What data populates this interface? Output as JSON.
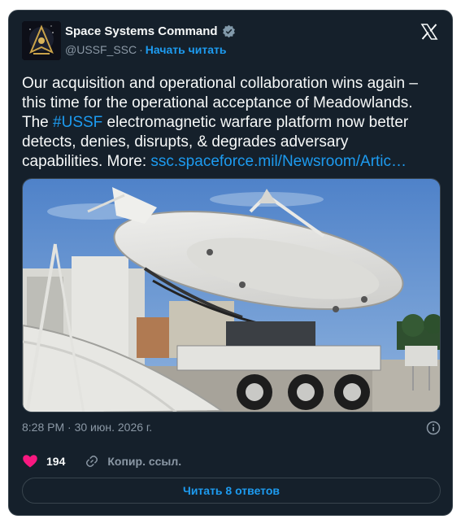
{
  "tweet": {
    "author": {
      "display_name": "Space Systems Command",
      "handle": "@USSF_SSC",
      "separator": "·",
      "follow_label": "Начать читать",
      "verified_icon": "verified-badge-icon"
    },
    "text_before_hashtag": "Our acquisition and operational collaboration wins again –\nthis time for the operational acceptance of Meadowlands.\nThe ",
    "hashtag": "#USSF",
    "text_after_hashtag": " electromagnetic warfare platform now better\ndetects, denies, disrupts, & degrades adversary\ncapabilities. More: ",
    "link": "ssc.spaceforce.mil/Newsroom/Artic…",
    "timestamp": "8:28 PM · 30 июн. 2026 г.",
    "likes": "194",
    "copy_link_label": "Копир. ссыл.",
    "replies_button_label": "Читать 8 ответов"
  },
  "colors": {
    "background": "#15202b",
    "accent": "#1d9bf0",
    "like": "#f91880",
    "muted": "#8b98a5"
  }
}
